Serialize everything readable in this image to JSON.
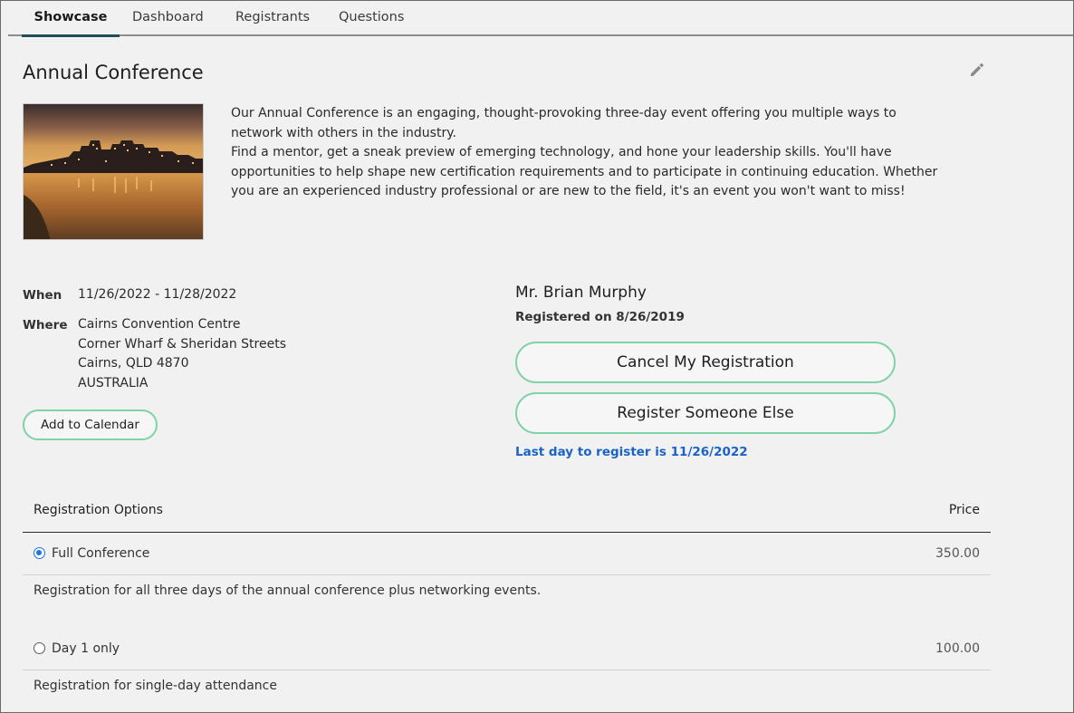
{
  "tabs": [
    {
      "label": "Showcase",
      "active": true
    },
    {
      "label": "Dashboard"
    },
    {
      "label": "Registrants"
    },
    {
      "label": "Questions"
    }
  ],
  "event": {
    "title": "Annual Conference",
    "description_lines": [
      "Our Annual Conference is an engaging, thought-provoking three-day event offering you multiple ways to",
      "network with others in the industry.",
      "Find a mentor, get a sneak preview of emerging technology, and hone your leadership skills. You'll have",
      "opportunities to help shape new certification requirements and to participate in continuing education. Whether",
      "you are an experienced industry professional or are new to the field, it's an event you won't want to miss!"
    ],
    "when_label": "When",
    "when_value": "11/26/2022 - 11/28/2022",
    "where_label": "Where",
    "where_lines": [
      "Cairns Convention Centre",
      "Corner Wharf & Sheridan Streets",
      "Cairns, QLD 4870",
      "AUSTRALIA"
    ],
    "add_to_calendar_label": "Add to Calendar"
  },
  "registration": {
    "name": "Mr. Brian Murphy",
    "registered_on": "Registered on 8/26/2019",
    "cancel_label": "Cancel My Registration",
    "register_other_label": "Register Someone Else",
    "last_day": "Last day to register is 11/26/2022"
  },
  "options": {
    "header_left": "Registration Options",
    "header_right": "Price",
    "items": [
      {
        "name": "Full Conference",
        "price": "350.00",
        "selected": true,
        "description": "Registration for all three days of the annual conference plus networking events."
      },
      {
        "name": "Day 1 only",
        "price": "100.00",
        "selected": false,
        "description": "Registration for single-day attendance"
      }
    ]
  },
  "colors": {
    "accent_border": "#7ed3a8",
    "link_blue": "#1a63c6",
    "tab_underline": "#1f4e59"
  },
  "icons": {
    "edit": "pencil-icon"
  }
}
